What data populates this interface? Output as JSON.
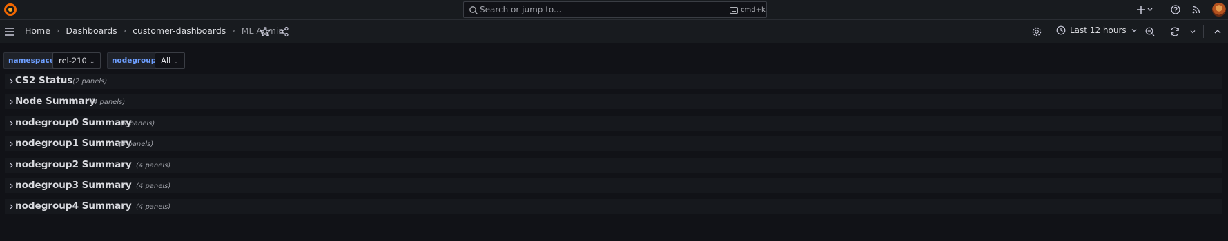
{
  "topbar": {
    "search_placeholder": "Search or jump to...",
    "search_shortcut": "cmd+k"
  },
  "breadcrumb": [
    "Home",
    "Dashboards",
    "customer-dashboards",
    "ML Admin"
  ],
  "time_range": "Last 12 hours",
  "variables": [
    {
      "name": "namespace",
      "value": "rel-210"
    },
    {
      "name": "nodegroup",
      "value": "All"
    }
  ],
  "rows": [
    {
      "title": "CS2 Status",
      "count": "(2 panels)"
    },
    {
      "title": "Node Summary",
      "count": "(4 panels)"
    },
    {
      "title": "nodegroup0 Summary",
      "count": "(4 panels)"
    },
    {
      "title": "nodegroup1 Summary",
      "count": "(4 panels)"
    },
    {
      "title": "nodegroup2 Summary",
      "count": "(4 panels)"
    },
    {
      "title": "nodegroup3 Summary",
      "count": "(4 panels)"
    },
    {
      "title": "nodegroup4 Summary",
      "count": "(4 panels)"
    }
  ],
  "colors": {
    "background": "#111217",
    "panel": "#181b1f",
    "accent_blue": "#6e9fff",
    "logo_orange": "#f46800"
  }
}
